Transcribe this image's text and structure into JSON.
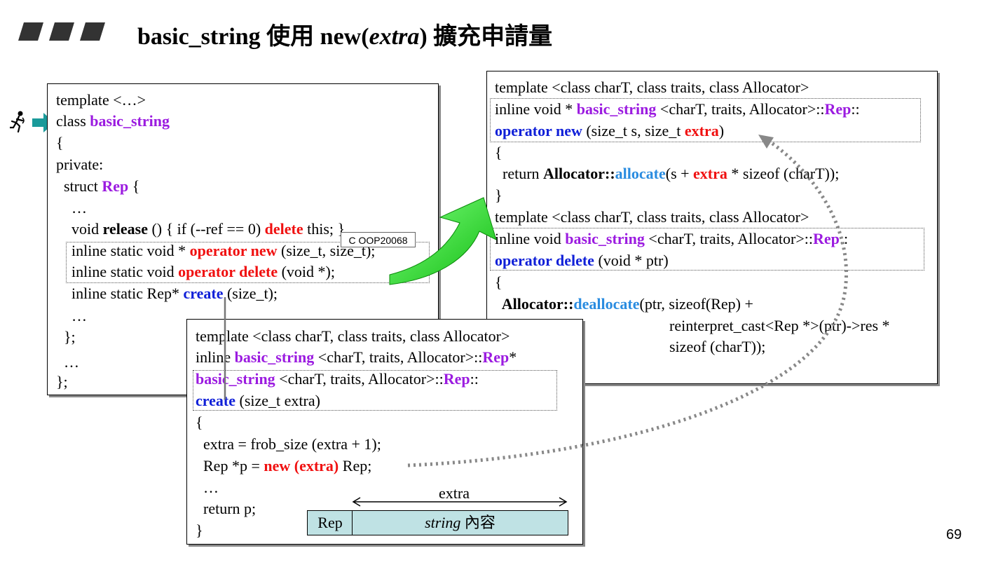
{
  "slide": {
    "title_prefix": "basic_string 使用 new(",
    "title_italic": "extra",
    "title_suffix": ") 擴充申請量",
    "page_number": "69",
    "tooltip": "C  OOP20068"
  },
  "left_code": {
    "l1": "template <…>",
    "l2_a": "class ",
    "l2_b": "basic_string",
    "l3": "{",
    "l4": "private:",
    "l5_a": "  struct ",
    "l5_b": "Rep",
    "l5_c": " {",
    "l6": "    …",
    "l7_a": "    void ",
    "l7_b": "release",
    "l7_c": " () { if (--ref == 0) ",
    "l7_d": "delete",
    "l7_e": " this; }",
    "l8_a": "    inline static void * ",
    "l8_b": "operator new",
    "l8_c": " (size_t, size_t);",
    "l9_a": "    inline static void ",
    "l9_b": "operator delete",
    "l9_c": " (void *);",
    "l10_a": "    inline static Rep* ",
    "l10_b": "create",
    "l10_c": " (size_t);",
    "l11": "    …",
    "l12": "  };",
    "l13": "  …",
    "l14": "};"
  },
  "right_code": {
    "l1": "template <class charT, class traits, class Allocator>",
    "l2_a": "inline void * ",
    "l2_b": "basic_string",
    "l2_c": " <charT, traits, Allocator>::",
    "l2_d": "Rep",
    "l2_e": "::",
    "l3_a": "operator new",
    "l3_b": " (size_t s, size_t ",
    "l3_c": "extra",
    "l3_d": ")",
    "l4": "{",
    "l5_a": "  return ",
    "l5_b": "Allocator::",
    "l5_c": "allocate",
    "l5_d": "(s + ",
    "l5_e": "extra",
    "l5_f": " * sizeof (charT));",
    "l6": "}",
    "l7": "template <class charT, class traits, class Allocator>",
    "l8_a": "inline void ",
    "l8_b": "basic_string",
    "l8_c": " <charT, traits, Allocator>::",
    "l8_d": "Rep",
    "l8_e": "::",
    "l9_a": "operator delete",
    "l9_b": " (void * ptr)",
    "l10": "{",
    "l11_a": "  Allocator::",
    "l11_b": "deallocate",
    "l11_c": "(ptr, sizeof(Rep) +",
    "l12": "reinterpret_cast<Rep *>(ptr)->res *",
    "l13": "sizeof (charT));"
  },
  "bottom_code": {
    "l1": "template <class charT, class traits, class Allocator>",
    "l2_a": "inline ",
    "l2_b": "basic_string",
    "l2_c": " <charT, traits, Allocator>::",
    "l2_d": "Rep",
    "l2_e": "*",
    "l3_a": "basic_string",
    "l3_b": " <charT, traits, Allocator>::",
    "l3_c": "Rep",
    "l3_d": "::",
    "l4_a": "create",
    "l4_b": " (size_t extra)",
    "l5": "{",
    "l6": "  extra = frob_size (extra + 1);",
    "l7_a": "  Rep *p = ",
    "l7_b": "new (extra)",
    "l7_c": " Rep;",
    "l8": "  …",
    "l9": "  return p;",
    "l10": "}"
  },
  "memory_diagram": {
    "extra_label": "extra",
    "rep_label": "Rep",
    "content_italic": "string",
    "content_suffix": " 內容",
    "fill_color": "#bfe2e4"
  },
  "colors": {
    "keyword_purple": "#9b1be0",
    "keyword_red": "#f01010",
    "keyword_blue": "#1020d8",
    "keyword_lightblue": "#2a8ce0",
    "arrow_green": "#22dd22",
    "pointer_teal": "#1a9a9a"
  },
  "icons": [
    "running-man-icon",
    "teal-pointer-arrow-icon",
    "green-curved-arrow-icon"
  ]
}
